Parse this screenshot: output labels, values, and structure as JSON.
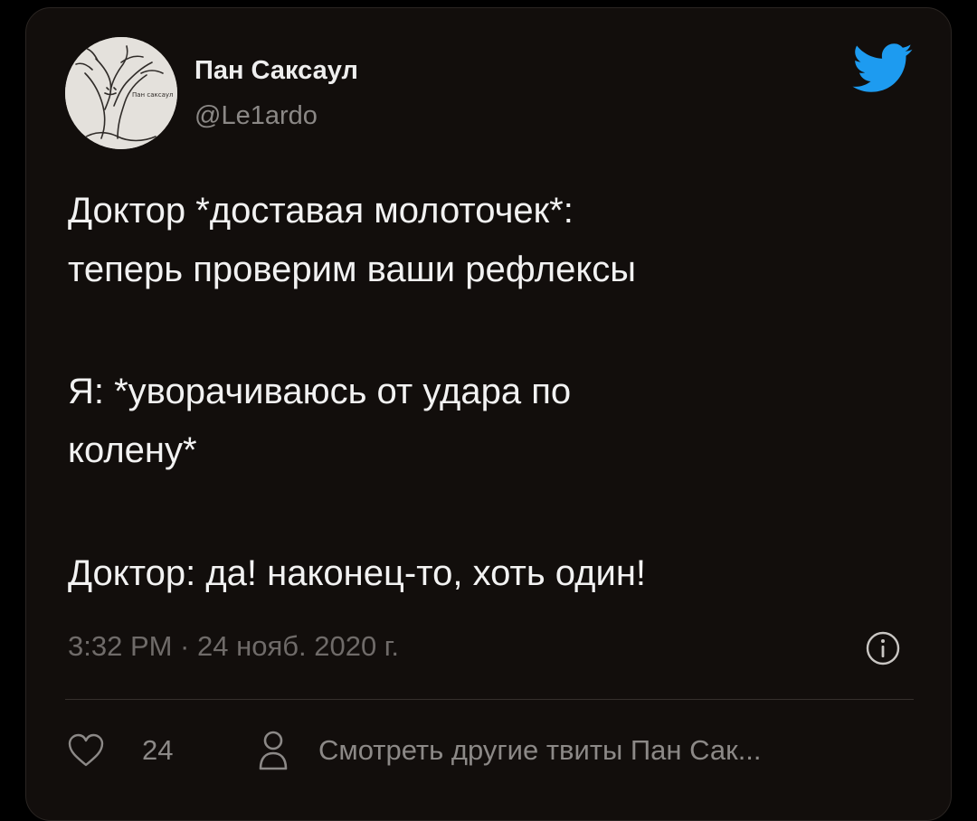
{
  "tweet": {
    "author_name": "Пан Саксаул",
    "author_handle": "@Le1ardo",
    "body_lines": [
      "Доктор *доставая молоточек*:",
      "теперь проверим ваши рефлексы",
      "Я: *уворачиваюсь от удара по",
      "колену*",
      "Доктор: да! наконец-то, хоть один!"
    ],
    "timestamp": "3:32 PM · 24 нояб. 2020 г.",
    "like_count": "24",
    "more_tweets_label": "Смотреть другие твиты Пан Сак..."
  },
  "avatar": {
    "text": "Пан саксаул"
  },
  "colors": {
    "background": "#000000",
    "card": "#120e0c",
    "text_primary": "#f2f2f2",
    "text_secondary": "#8c8987",
    "twitter_blue": "#1d9bf0"
  },
  "icons": {
    "brand": "twitter-bird-icon",
    "info": "info-icon",
    "like": "heart-icon",
    "profile": "person-icon"
  }
}
